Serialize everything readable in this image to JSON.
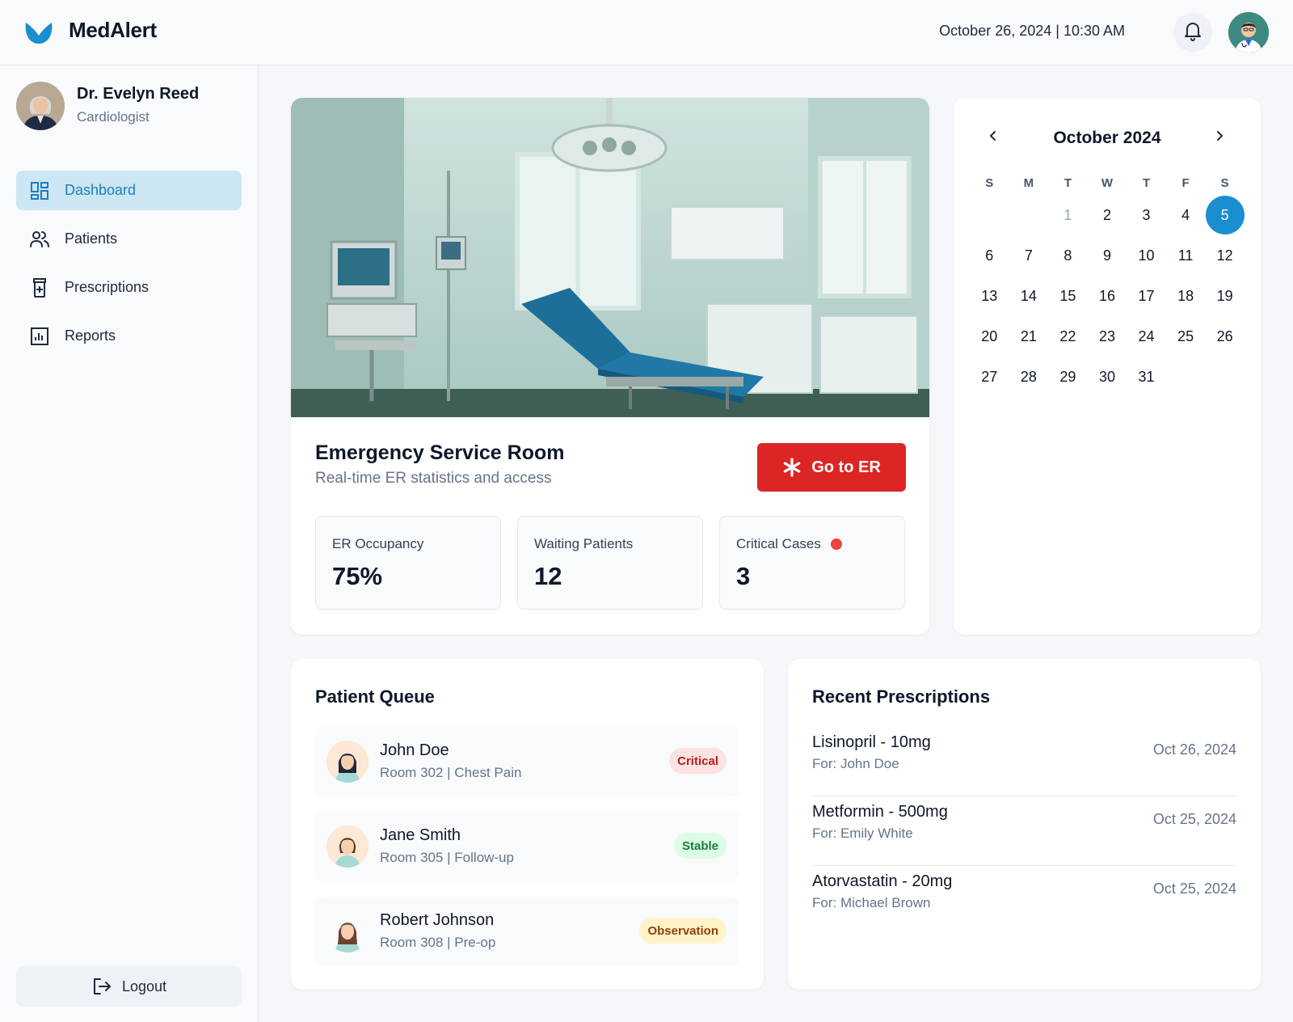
{
  "app": {
    "brand": "MedAlert",
    "datetime": "October 26, 2024 | 10:30 AM"
  },
  "profile": {
    "name": "Dr. Evelyn Reed",
    "role": "Cardiologist"
  },
  "nav": {
    "items": [
      {
        "label": "Dashboard",
        "icon": "dashboard-icon",
        "active": true
      },
      {
        "label": "Patients",
        "icon": "users-icon",
        "active": false
      },
      {
        "label": "Prescriptions",
        "icon": "pill-bottle-icon",
        "active": false
      },
      {
        "label": "Reports",
        "icon": "bar-chart-icon",
        "active": false
      }
    ],
    "logout_label": "Logout"
  },
  "er": {
    "title": "Emergency Service Room",
    "subtitle": "Real-time ER statistics and access",
    "button_label": "Go to ER",
    "stats": [
      {
        "label": "ER Occupancy",
        "value": "75%"
      },
      {
        "label": "Waiting Patients",
        "value": "12"
      },
      {
        "label": "Critical Cases",
        "value": "3"
      }
    ]
  },
  "calendar": {
    "month": "October 2024",
    "weekdays": [
      "S",
      "M",
      "T",
      "W",
      "T",
      "F",
      "S"
    ],
    "weeks": [
      [
        "",
        "",
        "1",
        "2",
        "3",
        "4",
        "5"
      ],
      [
        "6",
        "7",
        "8",
        "9",
        "10",
        "11",
        "12"
      ],
      [
        "13",
        "14",
        "15",
        "16",
        "17",
        "18",
        "19"
      ],
      [
        "20",
        "21",
        "22",
        "23",
        "24",
        "25",
        "26"
      ],
      [
        "27",
        "28",
        "29",
        "30",
        "31",
        "",
        ""
      ]
    ],
    "selected": "5"
  },
  "queue": {
    "title": "Patient Queue",
    "patients": [
      {
        "name": "John Doe",
        "detail": "Room 302 | Chest Pain",
        "status": "Critical"
      },
      {
        "name": "Jane Smith",
        "detail": "Room 305 | Follow-up",
        "status": "Stable"
      },
      {
        "name": "Robert Johnson",
        "detail": "Room 308 | Pre-op",
        "status": "Observation"
      }
    ]
  },
  "prescriptions": {
    "title": "Recent Prescriptions",
    "items": [
      {
        "name": "Lisinopril - 10mg",
        "for": "For: John Doe",
        "date": "Oct 26, 2024"
      },
      {
        "name": "Metformin - 500mg",
        "for": "For: Emily White",
        "date": "Oct 25, 2024"
      },
      {
        "name": "Atorvastatin - 20mg",
        "for": "For: Michael Brown",
        "date": "Oct 25, 2024"
      }
    ]
  },
  "colors": {
    "accent": "#1a8fcf",
    "danger": "#dc2626",
    "active_nav_bg": "#cde6f3"
  }
}
